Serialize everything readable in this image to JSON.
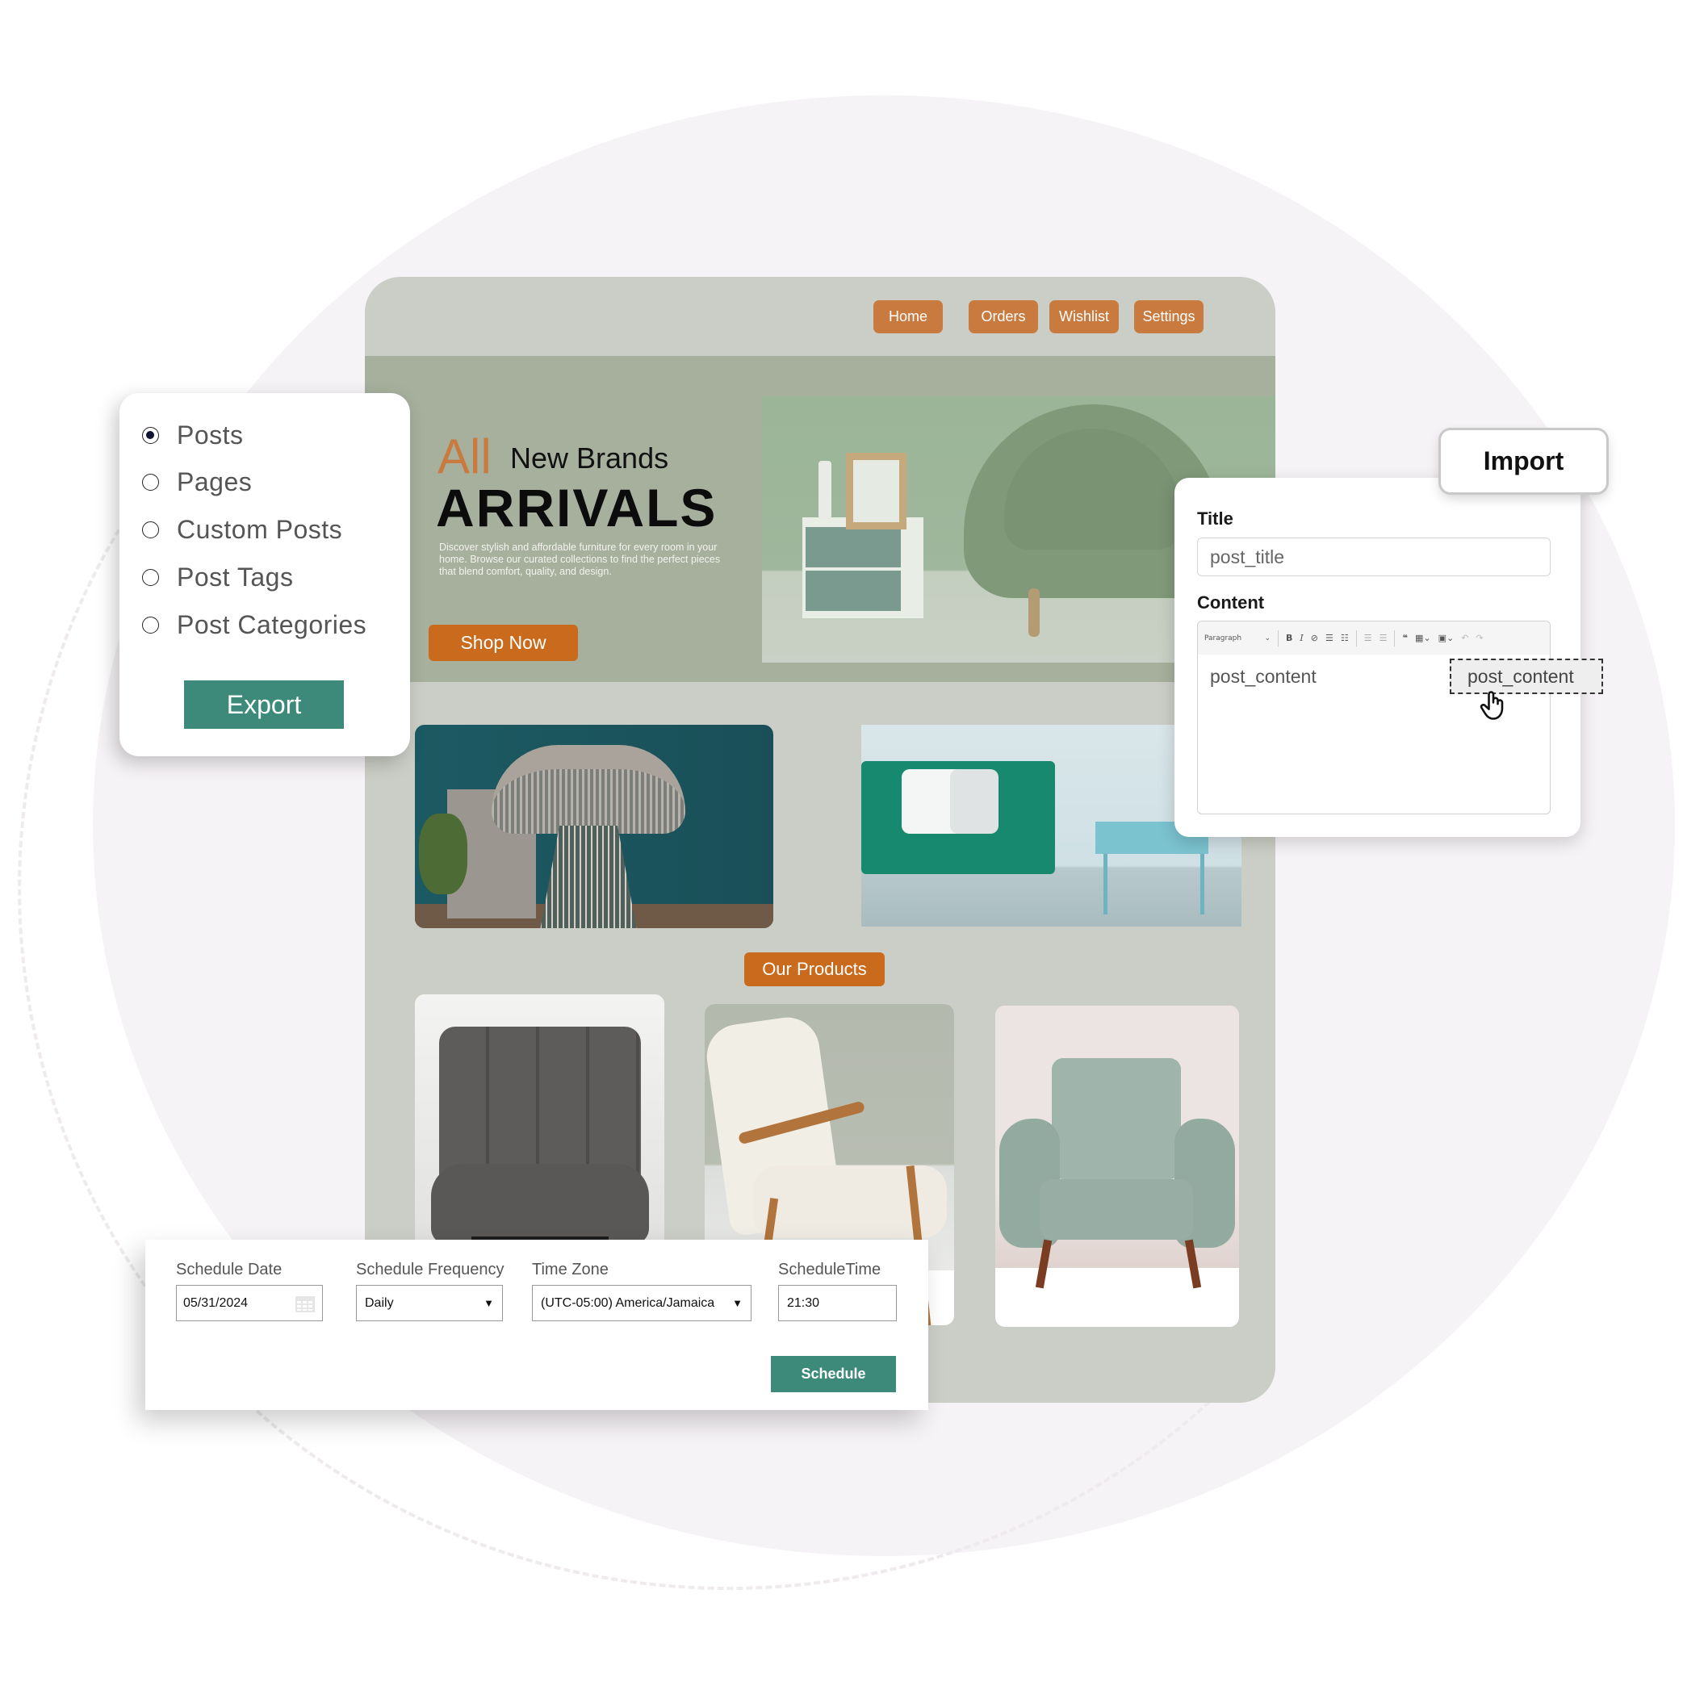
{
  "colors": {
    "accent_orange": "#c97a3e",
    "cta_orange": "#c96a1d",
    "primary_teal": "#3d8a7b",
    "site_bg": "#cbcec6",
    "hero_bg": "#a7af9d",
    "backdrop_circle": "#f6f3f6"
  },
  "site": {
    "nav": [
      "Home",
      "Orders",
      "Wishlist",
      "Settings"
    ],
    "hero": {
      "accent_word": "All",
      "subtitle": "New Brands",
      "title": "ARRIVALS",
      "description": "Discover stylish and affordable furniture for every room in your home. Browse our curated collections to find the perfect pieces that blend comfort, quality, and design.",
      "cta": "Shop Now"
    },
    "section_label": "Our Products",
    "products": [
      {
        "image": "grey-tufted-wingback-chair"
      },
      {
        "image": "cream-boucle-wooden-armchair"
      },
      {
        "image": "mint-tufted-armchair"
      }
    ],
    "feature_images": [
      "wire-pedestal-chair",
      "green-sofa-living-room"
    ]
  },
  "export_panel": {
    "options": [
      {
        "label": "Posts",
        "checked": true
      },
      {
        "label": "Pages",
        "checked": false
      },
      {
        "label": "Custom Posts",
        "checked": false
      },
      {
        "label": "Post Tags",
        "checked": false
      },
      {
        "label": "Post Categories",
        "checked": false
      }
    ],
    "button": "Export"
  },
  "import_panel": {
    "button": "Import",
    "title_label": "Title",
    "title_value": "post_title",
    "content_label": "Content",
    "toolbar": {
      "format": "Paragraph",
      "icons": [
        "bold-icon",
        "italic-icon",
        "link-icon",
        "bullet-list-icon",
        "numbered-list-icon",
        "outdent-icon",
        "indent-icon",
        "blockquote-icon",
        "table-icon",
        "media-icon",
        "undo-icon",
        "redo-icon"
      ]
    },
    "content_value": "post_content",
    "drag_chip": "post_content"
  },
  "schedule_panel": {
    "date_label": "Schedule Date",
    "date_value": "05/31/2024",
    "frequency_label": "Schedule Frequency",
    "frequency_value": "Daily",
    "timezone_label": "Time Zone",
    "timezone_value": "(UTC-05:00) America/Jamaica",
    "time_label": "ScheduleTime",
    "time_value": "21:30",
    "button": "Schedule"
  }
}
